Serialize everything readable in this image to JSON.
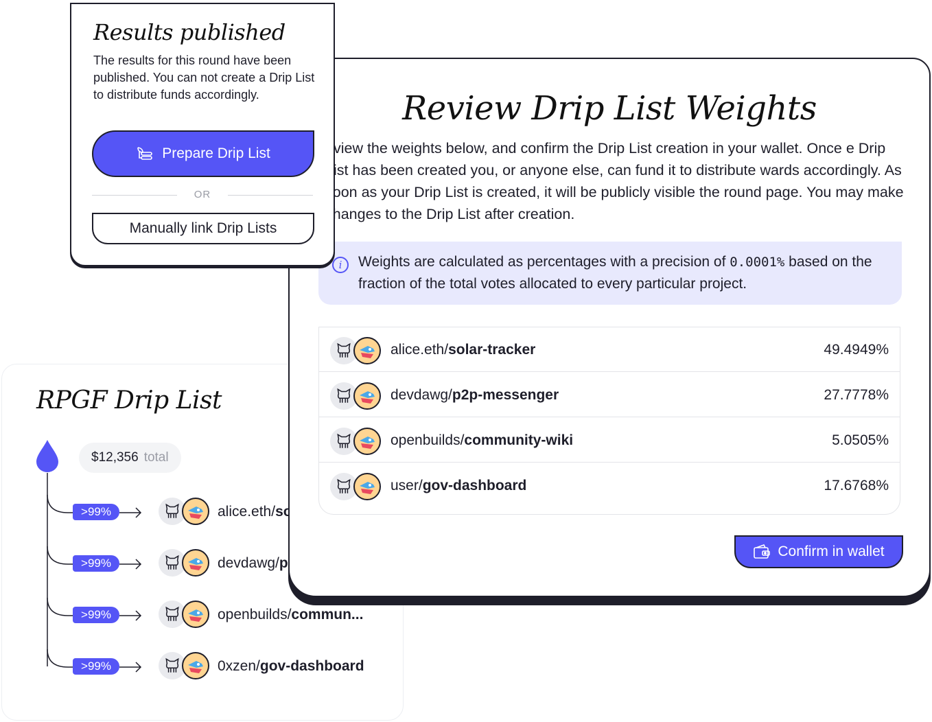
{
  "results_card": {
    "title": "Results published",
    "body": "The results for this round have been published. You can not create a Drip List to distribute funds accordingly.",
    "prepare_label": "Prepare Drip List",
    "or_label": "OR",
    "manual_label": "Manually link Drip Lists"
  },
  "review_card": {
    "title": "Review Drip List Weights",
    "body": "eview the weights below, and confirm the Drip List creation in your wallet. Once e Drip List has been created you, or anyone else, can fund it to distribute wards accordingly. As soon as your Drip List is created, it will be publicly visible the round page. You may make changes to the Drip List after creation.",
    "info_before": "Weights are calculated as percentages with a precision of ",
    "info_precision": "0.0001%",
    "info_after": " based on the fraction of the total votes allocated to every particular project.",
    "weights": [
      {
        "owner": "alice.eth/",
        "repo": "solar-tracker",
        "percent": "49.4949%"
      },
      {
        "owner": "devdawg/",
        "repo": "p2p-messenger",
        "percent": "27.7778%"
      },
      {
        "owner": "openbuilds/",
        "repo": "community-wiki",
        "percent": "5.0505%"
      },
      {
        "owner": "user/",
        "repo": "gov-dashboard",
        "percent": "17.6768%"
      }
    ],
    "confirm_label": "Confirm in wallet"
  },
  "drip_list": {
    "title": "RPGF Drip List",
    "total_amount": "$12,356",
    "total_label": "total",
    "recipients": [
      {
        "badge": ">99%",
        "owner": "alice.eth/",
        "repo": "solar-tracker"
      },
      {
        "badge": ">99%",
        "owner": "devdawg/",
        "repo": "p2p-messenger"
      },
      {
        "badge": ">99%",
        "owner": "openbuilds/",
        "repo": "commun..."
      },
      {
        "badge": ">99%",
        "owner": "0xzen/",
        "repo": "gov-dashboard"
      }
    ]
  },
  "colors": {
    "accent": "#5555f6",
    "ink": "#1e1e2a",
    "info_bg": "#e8e9fd"
  }
}
